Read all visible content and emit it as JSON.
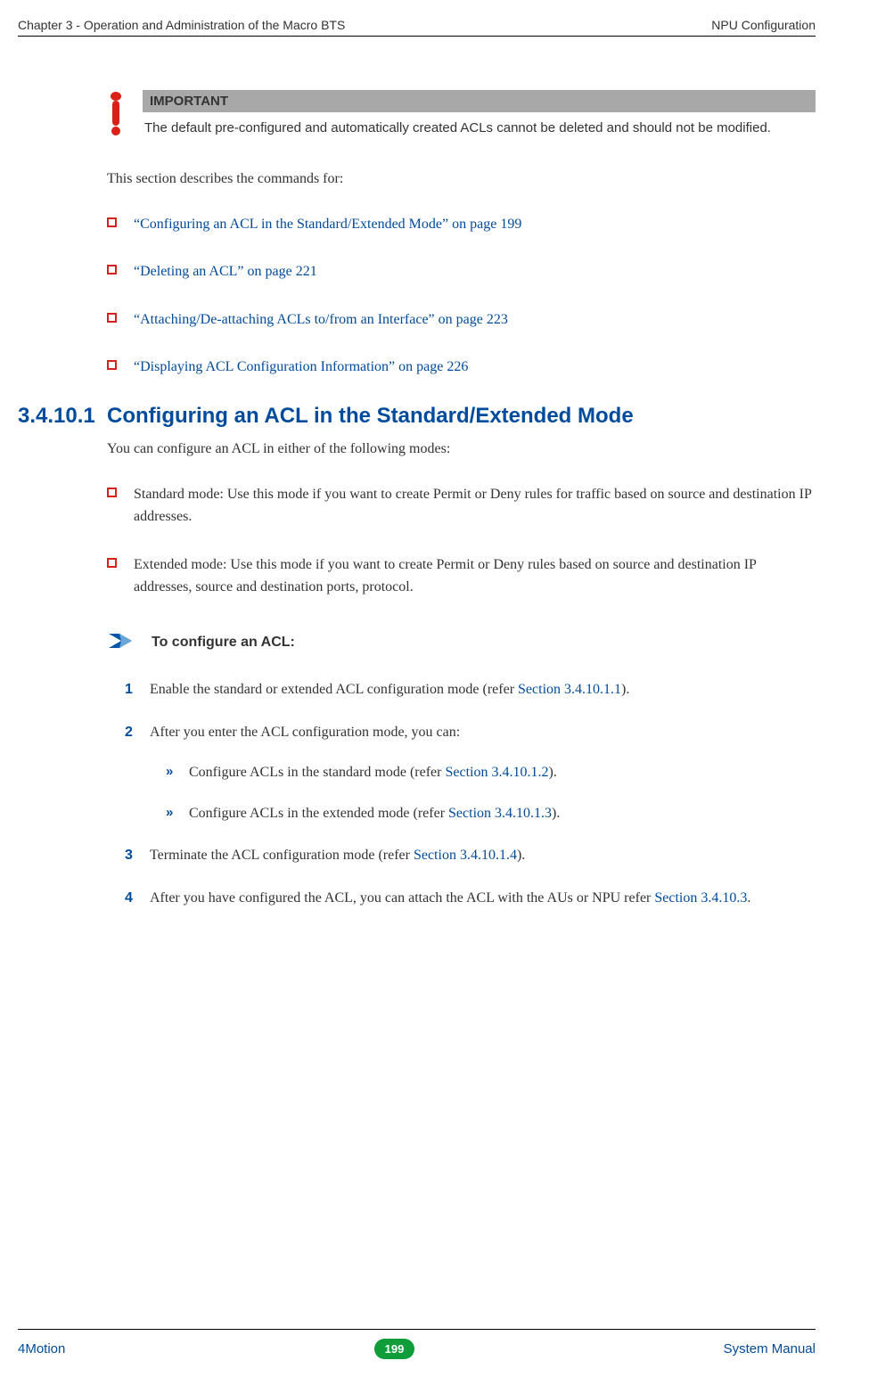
{
  "header": {
    "left": "Chapter 3 - Operation and Administration of the Macro BTS",
    "right": "NPU Configuration"
  },
  "important": {
    "title": "IMPORTANT",
    "text": "The default pre-configured and automatically created ACLs cannot be deleted and should not be modified."
  },
  "intro": "This section describes the commands for:",
  "links": [
    "“Configuring an ACL in the Standard/Extended Mode” on page 199",
    "“Deleting an ACL” on page 221",
    "“Attaching/De-attaching ACLs to/from an Interface” on page 223",
    "“Displaying ACL Configuration Information” on page 226"
  ],
  "section": {
    "num": "3.4.10.1",
    "title": "Configuring an ACL in the Standard/Extended Mode"
  },
  "section_intro": "You can configure an ACL in either of the following modes:",
  "modes": [
    "Standard mode: Use this mode if you want to create Permit or Deny rules for traffic based on source and destination IP addresses.",
    "Extended mode: Use this mode if you want to create Permit or Deny rules based on source and destination IP addresses, source and destination ports, protocol."
  ],
  "procedure_title": "To configure an ACL:",
  "steps": {
    "s1_pre": "Enable the standard or extended ACL configuration mode (refer ",
    "s1_link": "Section 3.4.10.1.1",
    "s1_post": ").",
    "s2": "After you enter the ACL configuration mode, you can:",
    "s2a_pre": "Configure ACLs in the standard mode (refer ",
    "s2a_link": "Section 3.4.10.1.2",
    "s2a_post": ").",
    "s2b_pre": "Configure ACLs in the extended mode (refer ",
    "s2b_link": "Section 3.4.10.1.3",
    "s2b_post": ").",
    "s3_pre": "Terminate the ACL configuration mode (refer ",
    "s3_link": "Section 3.4.10.1.4",
    "s3_post": ").",
    "s4_pre": "After you have configured the ACL, you can attach the ACL with the AUs or NPU refer ",
    "s4_link": "Section 3.4.10.3",
    "s4_post": "."
  },
  "footer": {
    "left": "4Motion",
    "page": "199",
    "right": "System Manual"
  },
  "step_numbers": {
    "n1": "1",
    "n2": "2",
    "n3": "3",
    "n4": "4"
  },
  "chevron": "»"
}
